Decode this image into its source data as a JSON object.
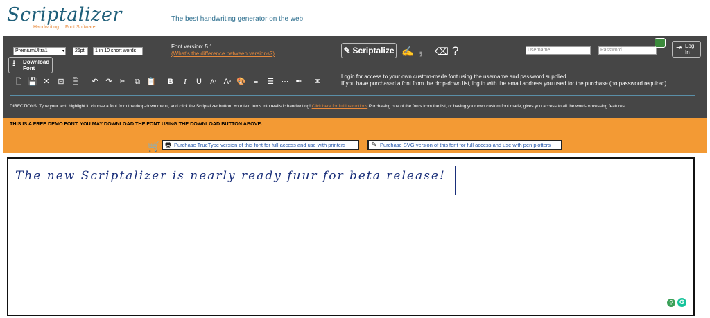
{
  "header": {
    "logo_title": "Scriptalizer",
    "logo_sub1": "Handwriting",
    "logo_sub2": "Font Software",
    "tagline": "The best handwriting generator on the web"
  },
  "controls": {
    "font_selected": "PremiumUltra1",
    "size_selected": "26pt",
    "words_selected": "1 in 10 short words",
    "version_label": "Font version: 5.1",
    "version_link": "(What's the difference between versions?)",
    "scriptalize_label": "Scriptalize",
    "download_label_1": "Download",
    "download_label_2": "Font"
  },
  "login": {
    "username_placeholder": "Username",
    "password_placeholder": "Password",
    "login_label_1": "Log",
    "login_label_2": "In",
    "info_line1": "Login for access to your own custom-made font using the username and password supplied.",
    "info_line2": "If you have purchased a font from the drop-down list, log in with the email address you used for the purchase (no password required)."
  },
  "directions": {
    "text_before": "DIRECTIONS: Type your text, highlight it, choose a font from the drop-down menu, and click the Scriptalizer button. Your text turns into realistic handwriting! ",
    "link_text": "Click here for full instructions",
    "text_after": " Purchasing one of the fonts from the list, or having your own custom font made, gives you access to all the word-processing features."
  },
  "demo": {
    "notice": "THIS IS A FREE DEMO FONT. YOU MAY DOWNLOAD THE FONT USING THE DOWNLOAD BUTTON ABOVE.",
    "buy_truetype": "Purchase TrueType version of this font for full access and use with printers",
    "buy_svg": "Purchase SVG version of this font for full access and use with pen plotters"
  },
  "editor": {
    "content": "The new Scriptalizer is nearly ready fuur for beta release!"
  },
  "toolbar": {
    "bold": "B",
    "italic": "I",
    "underline": "U"
  },
  "colors": {
    "panel": "#464646",
    "orange": "#f39a34",
    "accent_link": "#e8893a",
    "ink": "#1a2f7a"
  }
}
